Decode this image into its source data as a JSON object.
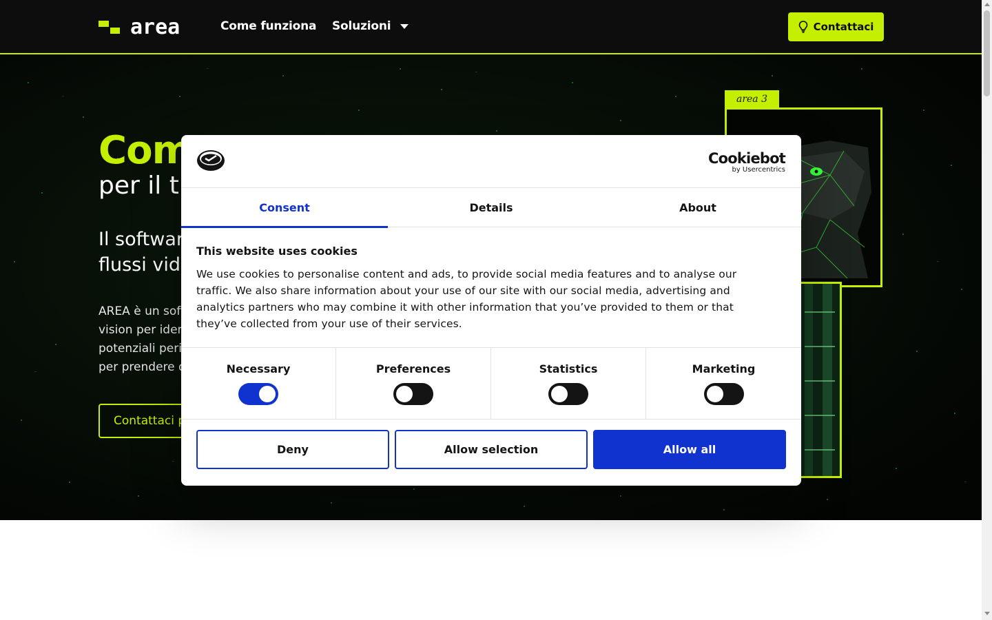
{
  "header": {
    "logo_text": "area",
    "nav": [
      {
        "label": "Come funziona"
      },
      {
        "label": "Soluzioni"
      }
    ],
    "cta_label": "Contattaci",
    "accent_color": "#c4f000"
  },
  "hero": {
    "title": "Com",
    "subtitle": "per il t",
    "lead": "Il softwar\nflussi vid",
    "text": "AREA è un soft\nvision per ident\npotenziali peric\nper prendere d",
    "cta_label": "Contattaci p",
    "card_tag": "area 3"
  },
  "cookie_dialog": {
    "brand_main": "Cookiebot",
    "brand_sub": "by Usercentrics",
    "tabs": [
      {
        "label": "Consent",
        "active": true
      },
      {
        "label": "Details",
        "active": false
      },
      {
        "label": "About",
        "active": false
      }
    ],
    "heading": "This website uses cookies",
    "body": "We use cookies to personalise content and ads, to provide social media features and to analyse our traffic. We also share information about your use of our site with our social media, advertising and analytics partners who may combine it with other information that you’ve provided to them or that they’ve collected from your use of their services.",
    "categories": [
      {
        "label": "Necessary",
        "enabled": true
      },
      {
        "label": "Preferences",
        "enabled": false
      },
      {
        "label": "Statistics",
        "enabled": false
      },
      {
        "label": "Marketing",
        "enabled": false
      }
    ],
    "buttons": {
      "deny": "Deny",
      "allow_selection": "Allow selection",
      "allow_all": "Allow all"
    },
    "primary_color": "#1032cf"
  }
}
